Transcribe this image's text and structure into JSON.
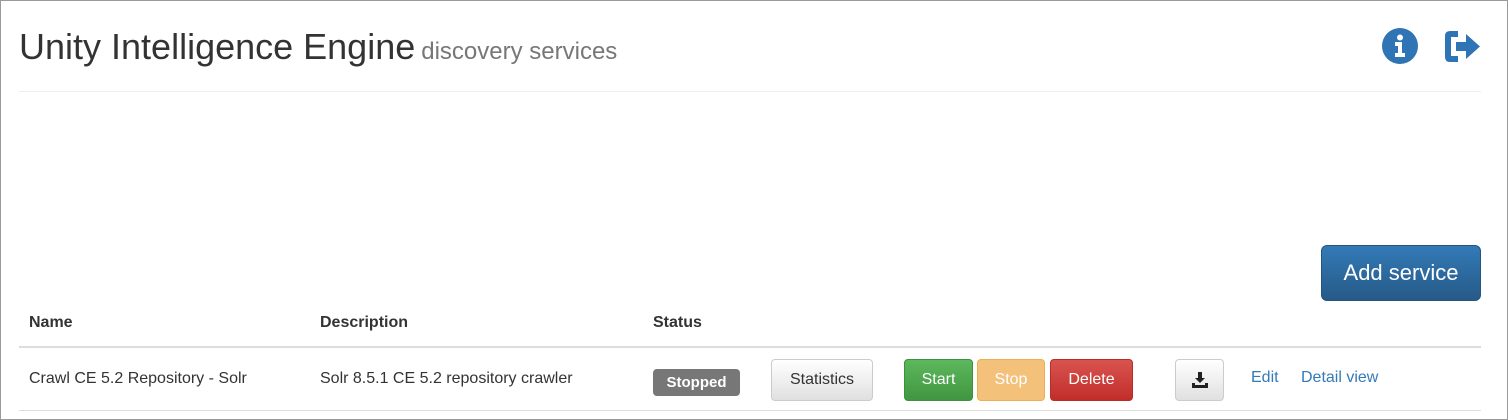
{
  "header": {
    "title": "Unity Intelligence Engine",
    "subtitle": "discovery services",
    "info_icon": "info-circle-icon",
    "logout_icon": "log-out-icon",
    "icon_color": "#2f74b5"
  },
  "actions": {
    "add_service_label": "Add service"
  },
  "table": {
    "columns": [
      "Name",
      "Description",
      "Status"
    ],
    "rows": [
      {
        "name": "Crawl CE 5.2 Repository - Solr",
        "description": "Solr 8.5.1 CE 5.2 repository crawler",
        "status": "Stopped",
        "buttons": {
          "statistics": "Statistics",
          "start": "Start",
          "stop": "Stop",
          "delete": "Delete",
          "download_icon": "download-icon",
          "edit": "Edit",
          "detail_view": "Detail view"
        }
      }
    ]
  },
  "colors": {
    "primary": "#337ab7",
    "success": "#5cb85c",
    "warning": "#f0ad4e",
    "danger": "#d9534f",
    "status_badge": "#777777"
  }
}
